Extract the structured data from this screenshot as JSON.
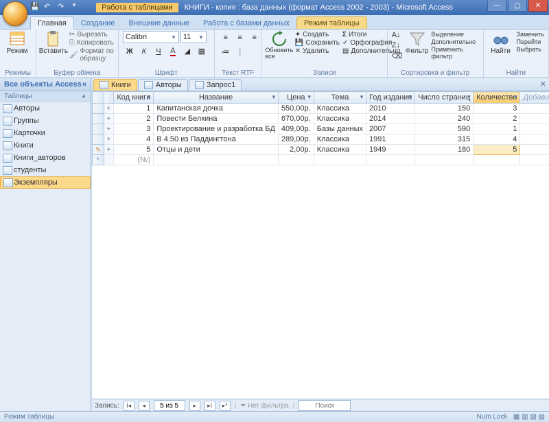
{
  "title": {
    "context_tab": "Работа с таблицами",
    "document": "КНИГИ - копия : база данных (формат Access 2002 - 2003) - Microsoft Access"
  },
  "ribbon_tabs": [
    "Главная",
    "Создание",
    "Внешние данные",
    "Работа с базами данных",
    "Режим таблицы"
  ],
  "ribbon": {
    "grp_views": "Режимы",
    "btn_view": "Режим",
    "grp_clip": "Буфер обмена",
    "btn_paste": "Вставить",
    "clip_cut": "Вырезать",
    "clip_copy": "Копировать",
    "clip_fmt": "Формат по образцу",
    "grp_font": "Шрифт",
    "font_name": "Calibri",
    "font_size": "11",
    "grp_rtf": "Текст RTF",
    "grp_records": "Записи",
    "btn_refresh": "Обновить все",
    "rec_new": "Создать",
    "rec_save": "Сохранить",
    "rec_del": "Удалить",
    "rec_totals": "Итоги",
    "rec_spell": "Орфография",
    "rec_more": "Дополнительно",
    "grp_sortfilter": "Сортировка и фильтр",
    "btn_filter": "Фильтр",
    "sf_sel": "Выделение",
    "sf_adv": "Дополнительно",
    "sf_toggle": "Применить фильтр",
    "grp_find": "Найти",
    "btn_find": "Найти",
    "find_replace": "Заменить",
    "find_goto": "Перейти",
    "find_select": "Выбрать"
  },
  "nav": {
    "header": "Все объекты Access",
    "section": "Таблицы",
    "items": [
      "Авторы",
      "Группы",
      "Карточки",
      "Книги",
      "Книги_авторов",
      "студенты",
      "Экземпляры"
    ],
    "selected_index": 6
  },
  "doc_tabs": [
    {
      "label": "Книги",
      "kind": "table",
      "active": true
    },
    {
      "label": "Авторы",
      "kind": "table",
      "active": false
    },
    {
      "label": "Запрос1",
      "kind": "query",
      "active": false
    }
  ],
  "table": {
    "columns": [
      "Код книги",
      "Название",
      "Цена",
      "Тема",
      "Год издания",
      "Число страниц",
      "Количество"
    ],
    "add_field": "Добавить поле",
    "rows": [
      {
        "id": "1",
        "title": "Капитанская дочка",
        "price": "550,00р.",
        "topic": "Классика",
        "year": "2010",
        "pages": "150",
        "qty": "3"
      },
      {
        "id": "2",
        "title": "Повести Белкина",
        "price": "670,00р.",
        "topic": "Классика",
        "year": "2014",
        "pages": "240",
        "qty": "2"
      },
      {
        "id": "3",
        "title": "Проектирование и разработка БД",
        "price": "409,00р.",
        "topic": "Базы данных",
        "year": "2007",
        "pages": "590",
        "qty": "1"
      },
      {
        "id": "4",
        "title": "В 4.50 из Паддингтона",
        "price": "289,00р.",
        "topic": "Классика",
        "year": "1991",
        "pages": "315",
        "qty": "4"
      },
      {
        "id": "5",
        "title": "Отцы и дети",
        "price": "2,00р.",
        "topic": "Классика",
        "year": "1949",
        "pages": "180",
        "qty": "5"
      }
    ],
    "editing_row": 4,
    "selected_col": 6,
    "new_row_placeholder": "(№)"
  },
  "record_nav": {
    "label": "Запись:",
    "pos": "5 из 5",
    "no_filter": "Нет фильтра",
    "search": "Поиск"
  },
  "status": {
    "left": "Режим таблицы",
    "right": "Num Lock"
  }
}
